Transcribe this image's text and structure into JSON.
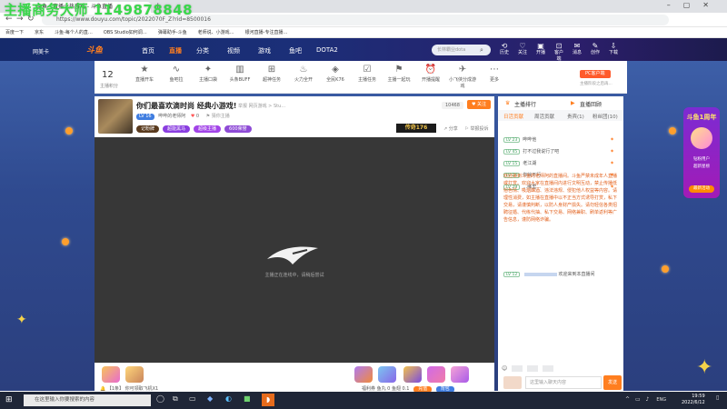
{
  "watermark": "主播商务大师 1149878848",
  "browser": {
    "tab_title": "斗鱼 - 直播火热游戏 - 斗鱼直播",
    "url": "https://www.douyu.com/topic/2022070F_Z?rid=8500016",
    "bookmarks": [
      "百度一下",
      "京东",
      "斗鱼-每个人的直…",
      "OBS Studio如何调…",
      "弹幕助手-斗鱼",
      "老师说、小游戏…",
      "银河直播-专注直播…"
    ]
  },
  "site": {
    "logo_prefix": "网美卡",
    "logo": "斗鱼",
    "nav": [
      "首页",
      "直播",
      "分类",
      "视频",
      "游戏",
      "鱼吧",
      "DOTA2"
    ],
    "nav_active": "直播",
    "search_placeholder": "长林霸业dota",
    "header_icons": [
      {
        "icon": "history-icon",
        "label": "历史"
      },
      {
        "icon": "follow-icon",
        "label": "关注"
      },
      {
        "icon": "broadcast-icon",
        "label": "开播"
      },
      {
        "icon": "message-icon",
        "label": "客户端"
      },
      {
        "icon": "bell-icon",
        "label": "消息"
      },
      {
        "icon": "user-icon",
        "label": "创作"
      },
      {
        "icon": "download-icon",
        "label": "下载"
      }
    ]
  },
  "toolbar": {
    "level_number": "12",
    "level_label": "主播积分",
    "items": [
      {
        "label": "直播开车",
        "icon": "★"
      },
      {
        "label": "鱼吧拉",
        "icon": "∿"
      },
      {
        "label": "主播口袋",
        "icon": "✦"
      },
      {
        "label": "头条BUFF",
        "icon": "▥"
      },
      {
        "label": "超神任务",
        "icon": "⊞"
      },
      {
        "label": "火力全开",
        "icon": "♨"
      },
      {
        "label": "全民K76",
        "icon": "◈"
      },
      {
        "label": "主播任务",
        "icon": "☑"
      },
      {
        "label": "主播一起玩",
        "icon": "⚑"
      },
      {
        "label": "开播提醒",
        "icon": "⏰"
      },
      {
        "label": "小飞侠分成游戏",
        "icon": "✈"
      },
      {
        "label": "更多",
        "icon": "⋯"
      }
    ],
    "pc_badge": "PC客户端",
    "pc_sub": "主播阶段之后再..."
  },
  "room": {
    "title": "你们最喜欢滴时尚 经典小游戏!",
    "meta": "举报  网页游戏 > Stu…",
    "anchor_level": "LV 16",
    "anchor_name": "哔哔的老师阿",
    "follow_count": "0",
    "report": "猜你主播",
    "tags": [
      {
        "label": "记粉牌",
        "color": "#5a3b1e"
      },
      {
        "label": "超能黑马",
        "color": "#8a3ee0"
      },
      {
        "label": "超级主播",
        "color": "#a244e8"
      },
      {
        "label": "600荣誉",
        "color": "#8e4bd6"
      }
    ],
    "viewers": "10468",
    "follow_label": "关注",
    "banner": "传奇176",
    "share_label": "分享",
    "report_label": "举报投诉",
    "loading_text": "主播正在连线中，请稍后尝试",
    "bottom_user_text": "【1条】 你可领取飞机X1",
    "bottom_stats": "福利券  鱼丸 0  鱼翅 0.1",
    "recharge_label": "充值",
    "backpack_label": "背包"
  },
  "panel": {
    "rank_title": "主播排行",
    "rank_live": "直播回顾",
    "tabs": [
      "日活贡献",
      "周活贡献",
      "贵宾(1)",
      "粉丝团(10)"
    ],
    "active_tab": "日活贡献",
    "chats": [
      {
        "level": "LV 23",
        "name": "哔哔他"
      },
      {
        "level": "LV 45",
        "name": "打不过我说行了吧"
      },
      {
        "level": "LV 15",
        "name": "老江湖"
      },
      {
        "level": "LV 24",
        "name": "你就不行"
      },
      {
        "level": "LV 29",
        "name": "…哪里…"
      }
    ],
    "system_message": "欢迎来到斗鱼的老师阿的直播间。斗鱼严禁未成年人直播或打赏。欢迎大家在直播间内进行文明互动，禁止传播低俗色情、吸烟酗酒、违法违规、侵犯他人权益等内容。请理性消费，如主播在直播中以不正当方式诱导打赏，私下交易，请谨慎判断，以防人身财产损失。请勿轻信各类招聘征婚、代练代抽、私下交易、网络兼职、刷单返利等广告信息，谨防网络诈骗。",
    "welcome_level": "LV 12",
    "welcome_text": "欢迎来到本直播间",
    "input_placeholder": "这里输入聊天内容",
    "send_label": "发送"
  },
  "side_activity": {
    "title": "斗鱼1周年",
    "sub1": "钻粉用户",
    "sub2": "超新星榜",
    "button": "最新活动"
  },
  "taskbar": {
    "search_placeholder": "在这里输入你要搜索的内容",
    "time": "19:59",
    "date": "2022/6/12",
    "lang": "ENG"
  },
  "colors": {
    "accent": "#ff7e1f",
    "header_bg": "#1b2f78",
    "video_bg": "#373737"
  }
}
